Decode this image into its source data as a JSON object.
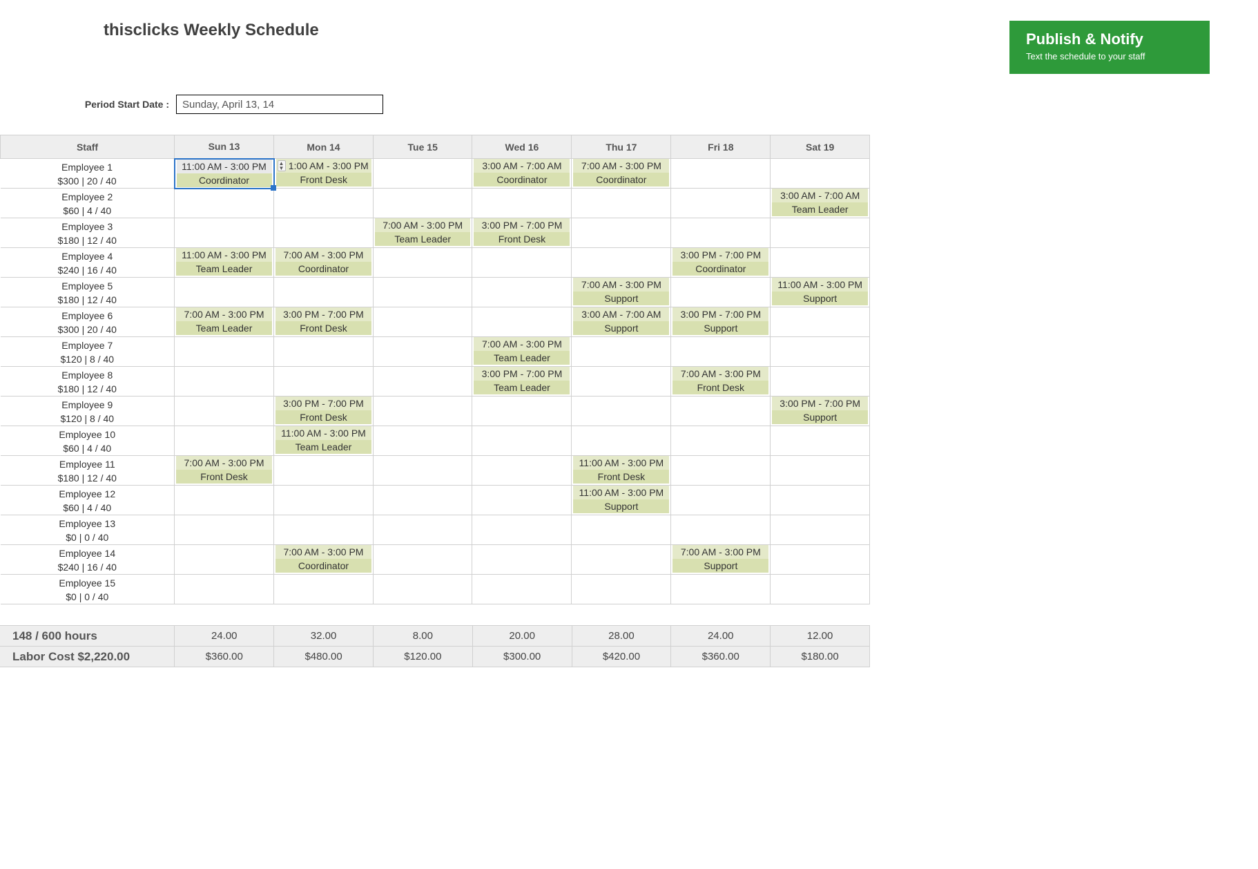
{
  "title": "thisclicks Weekly Schedule",
  "publish": {
    "title": "Publish & Notify",
    "sub": "Text the schedule to your staff"
  },
  "period": {
    "label": "Period Start Date :",
    "value": "Sunday, April 13, 14"
  },
  "headers": {
    "staff": "Staff",
    "days": [
      "Sun 13",
      "Mon 14",
      "Tue 15",
      "Wed 16",
      "Thu 17",
      "Fri 18",
      "Sat 19"
    ]
  },
  "employees": [
    {
      "name": "Employee 1",
      "stat": "$300 | 20 / 40",
      "shifts": [
        {
          "time": "11:00 AM - 3:00 PM",
          "role": "Coordinator",
          "sel": true
        },
        {
          "time": "1:00 AM - 3:00 PM",
          "role": "Front Desk",
          "stepper": true
        },
        null,
        {
          "time": "3:00 AM - 7:00 AM",
          "role": "Coordinator"
        },
        {
          "time": "7:00 AM - 3:00 PM",
          "role": "Coordinator"
        },
        null,
        null
      ]
    },
    {
      "name": "Employee 2",
      "stat": "$60 | 4 / 40",
      "shifts": [
        null,
        null,
        null,
        null,
        null,
        null,
        {
          "time": "3:00 AM - 7:00 AM",
          "role": "Team Leader"
        }
      ]
    },
    {
      "name": "Employee 3",
      "stat": "$180 | 12 / 40",
      "shifts": [
        null,
        null,
        {
          "time": "7:00 AM - 3:00 PM",
          "role": "Team Leader"
        },
        {
          "time": "3:00 PM - 7:00 PM",
          "role": "Front Desk"
        },
        null,
        null,
        null
      ]
    },
    {
      "name": "Employee 4",
      "stat": "$240 | 16 / 40",
      "shifts": [
        {
          "time": "11:00 AM - 3:00 PM",
          "role": "Team Leader"
        },
        {
          "time": "7:00 AM - 3:00 PM",
          "role": "Coordinator"
        },
        null,
        null,
        null,
        {
          "time": "3:00 PM - 7:00 PM",
          "role": "Coordinator"
        },
        null
      ]
    },
    {
      "name": "Employee 5",
      "stat": "$180 | 12 / 40",
      "shifts": [
        null,
        null,
        null,
        null,
        {
          "time": "7:00 AM - 3:00 PM",
          "role": "Support"
        },
        null,
        {
          "time": "11:00 AM - 3:00 PM",
          "role": "Support"
        }
      ]
    },
    {
      "name": "Employee 6",
      "stat": "$300 | 20 / 40",
      "shifts": [
        {
          "time": "7:00 AM - 3:00 PM",
          "role": "Team Leader"
        },
        {
          "time": "3:00 PM - 7:00 PM",
          "role": "Front Desk"
        },
        null,
        null,
        {
          "time": "3:00 AM - 7:00 AM",
          "role": "Support"
        },
        {
          "time": "3:00 PM - 7:00 PM",
          "role": "Support"
        },
        null
      ]
    },
    {
      "name": "Employee 7",
      "stat": "$120 | 8 / 40",
      "shifts": [
        null,
        null,
        null,
        {
          "time": "7:00 AM - 3:00 PM",
          "role": "Team Leader"
        },
        null,
        null,
        null
      ]
    },
    {
      "name": "Employee 8",
      "stat": "$180 | 12 / 40",
      "shifts": [
        null,
        null,
        null,
        {
          "time": "3:00 PM - 7:00 PM",
          "role": "Team Leader"
        },
        null,
        {
          "time": "7:00 AM - 3:00 PM",
          "role": "Front Desk"
        },
        null
      ]
    },
    {
      "name": "Employee 9",
      "stat": "$120 | 8 / 40",
      "shifts": [
        null,
        {
          "time": "3:00 PM - 7:00 PM",
          "role": "Front Desk"
        },
        null,
        null,
        null,
        null,
        {
          "time": "3:00 PM - 7:00 PM",
          "role": "Support"
        }
      ]
    },
    {
      "name": "Employee 10",
      "stat": "$60 | 4 / 40",
      "shifts": [
        null,
        {
          "time": "11:00 AM - 3:00 PM",
          "role": "Team Leader"
        },
        null,
        null,
        null,
        null,
        null
      ]
    },
    {
      "name": "Employee 11",
      "stat": "$180 | 12 / 40",
      "shifts": [
        {
          "time": "7:00 AM - 3:00 PM",
          "role": "Front Desk"
        },
        null,
        null,
        null,
        {
          "time": "11:00 AM - 3:00 PM",
          "role": "Front Desk"
        },
        null,
        null
      ]
    },
    {
      "name": "Employee 12",
      "stat": "$60 | 4 / 40",
      "shifts": [
        null,
        null,
        null,
        null,
        {
          "time": "11:00 AM - 3:00 PM",
          "role": "Support"
        },
        null,
        null
      ]
    },
    {
      "name": "Employee 13",
      "stat": "$0 | 0 / 40",
      "shifts": [
        null,
        null,
        null,
        null,
        null,
        null,
        null
      ]
    },
    {
      "name": "Employee 14",
      "stat": "$240 | 16 / 40",
      "shifts": [
        null,
        {
          "time": "7:00 AM - 3:00 PM",
          "role": "Coordinator"
        },
        null,
        null,
        null,
        {
          "time": "7:00 AM - 3:00 PM",
          "role": "Support"
        },
        null
      ]
    },
    {
      "name": "Employee 15",
      "stat": "$0 | 0 / 40",
      "shifts": [
        null,
        null,
        null,
        null,
        null,
        null,
        null
      ]
    }
  ],
  "footer": {
    "hours_label": "148 / 600 hours",
    "cost_label": "Labor Cost $2,220.00",
    "hours": [
      "24.00",
      "32.00",
      "8.00",
      "20.00",
      "28.00",
      "24.00",
      "12.00"
    ],
    "cost": [
      "$360.00",
      "$480.00",
      "$120.00",
      "$300.00",
      "$420.00",
      "$360.00",
      "$180.00"
    ]
  }
}
